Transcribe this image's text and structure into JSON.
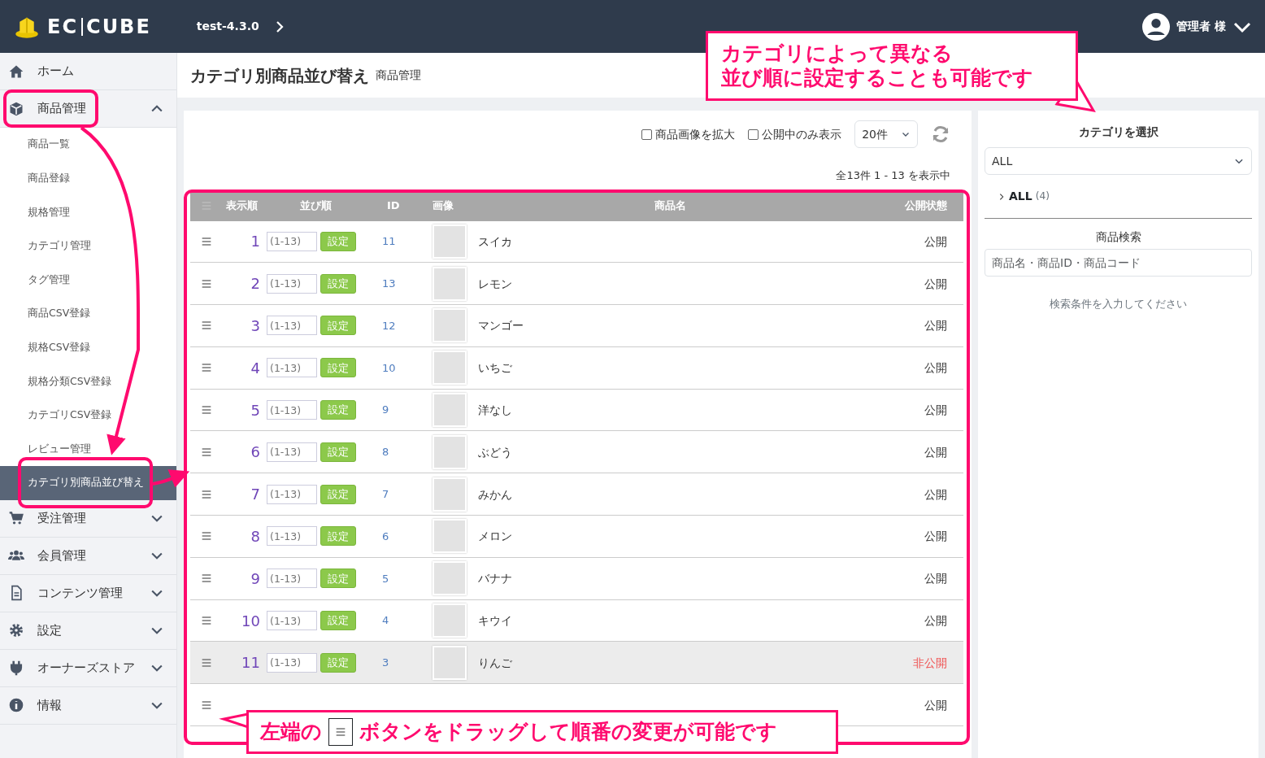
{
  "header": {
    "logo": [
      "EC",
      "CUBE"
    ],
    "shop": "test-4.3.0",
    "user": "管理者 様"
  },
  "sidebar": [
    {
      "label": "ホーム",
      "kind": "link"
    },
    {
      "label": "商品管理",
      "kind": "group",
      "expanded": true,
      "children": [
        {
          "label": "商品一覧",
          "selected": false
        },
        {
          "label": "商品登録",
          "selected": false
        },
        {
          "label": "規格管理",
          "selected": false
        },
        {
          "label": "カテゴリ管理",
          "selected": false
        },
        {
          "label": "タグ管理",
          "selected": false
        },
        {
          "label": "商品CSV登録",
          "selected": false
        },
        {
          "label": "規格CSV登録",
          "selected": false
        },
        {
          "label": "規格分類CSV登録",
          "selected": false
        },
        {
          "label": "カテゴリCSV登録",
          "selected": false
        },
        {
          "label": "レビュー管理",
          "selected": false
        },
        {
          "label": "カテゴリ別商品並び替え",
          "selected": true
        }
      ]
    },
    {
      "label": "受注管理",
      "kind": "group",
      "expanded": false
    },
    {
      "label": "会員管理",
      "kind": "group",
      "expanded": false
    },
    {
      "label": "コンテンツ管理",
      "kind": "group",
      "expanded": false
    },
    {
      "label": "設定",
      "kind": "group",
      "expanded": false
    },
    {
      "label": "オーナーズストア",
      "kind": "group",
      "expanded": false
    },
    {
      "label": "情報",
      "kind": "group",
      "expanded": false
    }
  ],
  "page": {
    "title": "カテゴリ別商品並び替え",
    "subtitle": "商品管理"
  },
  "toolbar": {
    "options": [
      {
        "label": "商品画像を拡大",
        "checked": false
      },
      {
        "label": "公開中のみ表示",
        "checked": false
      }
    ],
    "per_page": "20件"
  },
  "count": "全13件 1 - 13 を表示中",
  "table": {
    "columns": [
      "表示順",
      "並び順",
      "ID",
      "画像",
      "商品名",
      "公開状態"
    ],
    "rows": [
      {
        "number": "1",
        "placeholder": "(1-13)",
        "button": "設定",
        "id": "11",
        "name": "スイカ",
        "status": "公開",
        "published": true
      },
      {
        "number": "2",
        "placeholder": "(1-13)",
        "button": "設定",
        "id": "13",
        "name": "レモン",
        "status": "公開",
        "published": true
      },
      {
        "number": "3",
        "placeholder": "(1-13)",
        "button": "設定",
        "id": "12",
        "name": "マンゴー",
        "status": "公開",
        "published": true
      },
      {
        "number": "4",
        "placeholder": "(1-13)",
        "button": "設定",
        "id": "10",
        "name": "いちご",
        "status": "公開",
        "published": true
      },
      {
        "number": "5",
        "placeholder": "(1-13)",
        "button": "設定",
        "id": "9",
        "name": "洋なし",
        "status": "公開",
        "published": true
      },
      {
        "number": "6",
        "placeholder": "(1-13)",
        "button": "設定",
        "id": "8",
        "name": "ぶどう",
        "status": "公開",
        "published": true
      },
      {
        "number": "7",
        "placeholder": "(1-13)",
        "button": "設定",
        "id": "7",
        "name": "みかん",
        "status": "公開",
        "published": true
      },
      {
        "number": "8",
        "placeholder": "(1-13)",
        "button": "設定",
        "id": "6",
        "name": "メロン",
        "status": "公開",
        "published": true
      },
      {
        "number": "9",
        "placeholder": "(1-13)",
        "button": "設定",
        "id": "5",
        "name": "バナナ",
        "status": "公開",
        "published": true
      },
      {
        "number": "10",
        "placeholder": "(1-13)",
        "button": "設定",
        "id": "4",
        "name": "キウイ",
        "status": "公開",
        "published": true
      },
      {
        "number": "11",
        "placeholder": "(1-13)",
        "button": "設定",
        "id": "3",
        "name": "りんご",
        "status": "非公開",
        "published": false
      },
      {
        "status": "公開",
        "published": true
      }
    ]
  },
  "category_panel": {
    "label": "カテゴリを選択",
    "select": "ALL",
    "tree": [
      {
        "label": "ALL",
        "count": "(4)"
      }
    ],
    "search_label": "商品検索",
    "search_placeholder": "商品名・商品ID・商品コード",
    "hint": "検索条件を入力してください"
  },
  "callouts": {
    "top": [
      "カテゴリによって異なる",
      "並び順に設定することも可能です"
    ],
    "bottom": {
      "before": "左端の",
      "after": "ボタンをドラッグして順番の変更が可能です"
    }
  }
}
